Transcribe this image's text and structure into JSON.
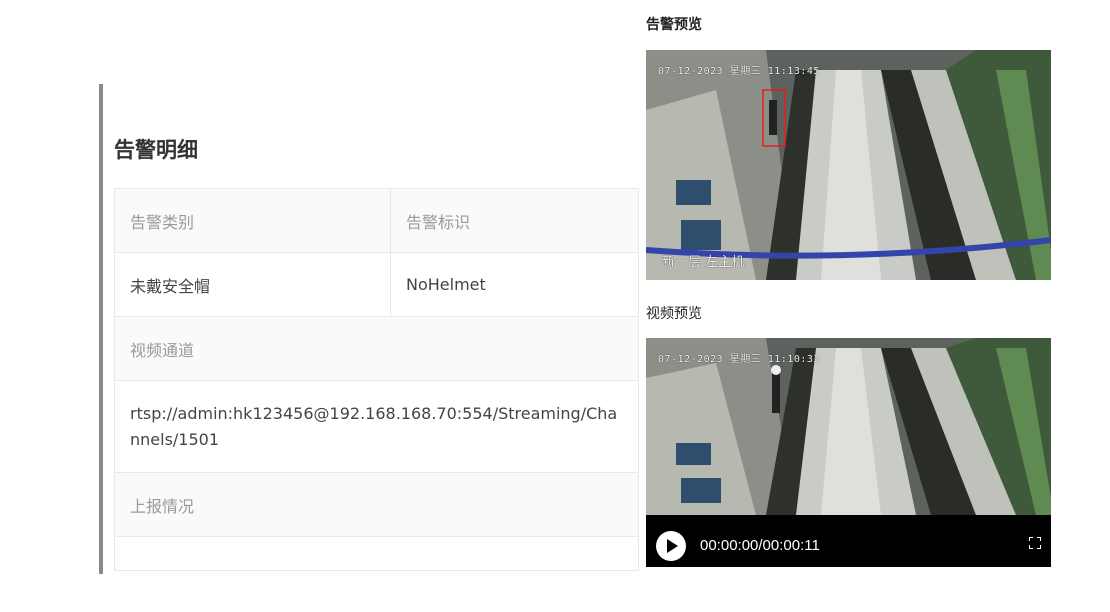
{
  "detail": {
    "title": "告警明细",
    "type_label": "告警类别",
    "tag_label": "告警标识",
    "type_value": "未戴安全帽",
    "tag_value": "NoHelmet",
    "channel_label": "视频通道",
    "channel_value": "rtsp://admin:hk123456@192.168.168.70:554/Streaming/Channels/1501",
    "report_label": "上报情况",
    "report_value": ""
  },
  "alarm_preview": {
    "title": "告警预览",
    "osd_datetime": "07-12-2023 星期三 11:13:45",
    "osd_location": "新一层 左主机",
    "detection_box_color": "#e02020"
  },
  "video_preview": {
    "title": "视频预览",
    "osd_datetime": "07-12-2023 星期三 11:10:33",
    "time_display": "00:00:00/00:00:11",
    "play_icon": "play-icon",
    "fullscreen_icon": "fullscreen-icon"
  }
}
